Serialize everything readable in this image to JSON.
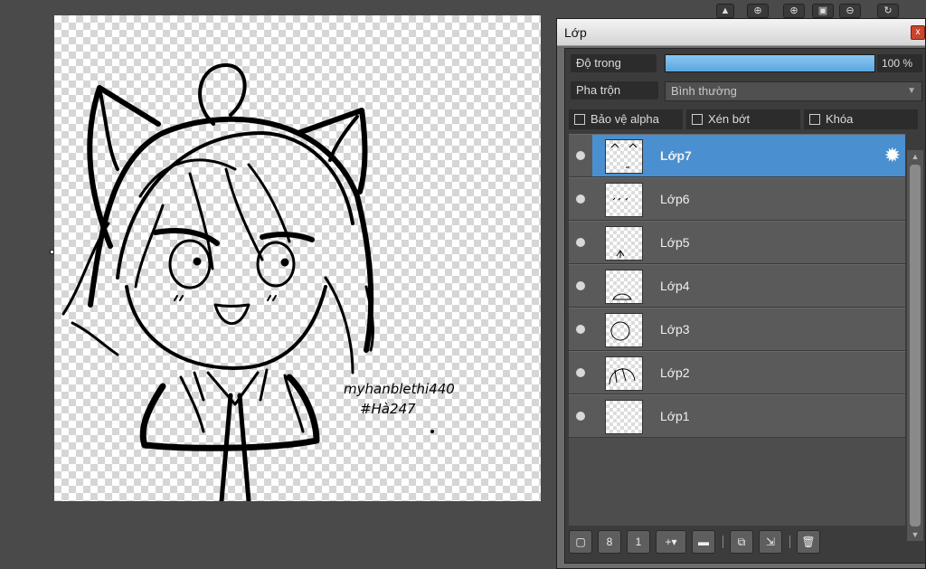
{
  "panel": {
    "title": "Lớp",
    "close": "x"
  },
  "opacity": {
    "label": "Độ trong",
    "value": "100 %",
    "fraction": 1.0
  },
  "blend": {
    "label": "Pha trộn",
    "value": "Bình thường"
  },
  "options": {
    "protect_alpha": "Bảo vệ alpha",
    "clipping": "Xén bớt",
    "lock": "Khóa"
  },
  "layers": [
    {
      "name": "Lớp7",
      "selected": true
    },
    {
      "name": "Lớp6"
    },
    {
      "name": "Lớp5"
    },
    {
      "name": "Lớp4"
    },
    {
      "name": "Lớp3"
    },
    {
      "name": "Lớp2"
    },
    {
      "name": "Lớp1"
    }
  ],
  "signature": {
    "line1": "myhanblethi440",
    "line2": "#Hà247"
  },
  "colors": {
    "accent": "#4a8fcf",
    "panel_bg": "#3c3c3c",
    "app_bg": "#4a4a4a"
  },
  "icons": [
    "close-icon",
    "gear-icon",
    "eye-icon",
    "new-layer-icon",
    "new-8bit-layer-icon",
    "new-1bit-layer-icon",
    "add-layer-menu-icon",
    "folder-icon",
    "duplicate-icon",
    "merge-icon",
    "delete-icon"
  ]
}
